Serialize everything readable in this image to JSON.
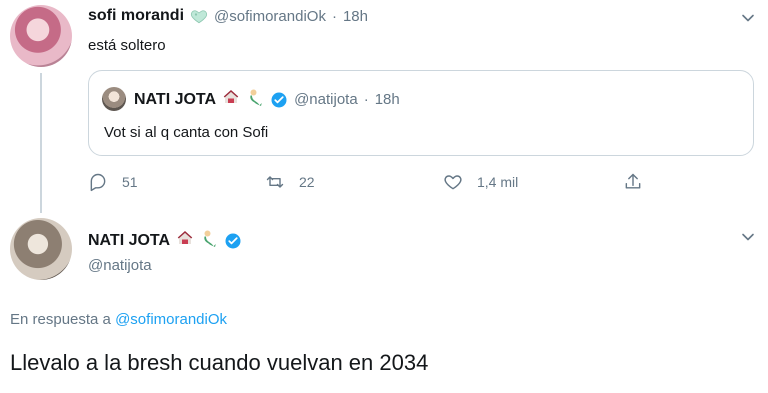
{
  "tweet1": {
    "name": "sofi morandi",
    "handle": "@sofimorandiOk",
    "separator": "·",
    "time": "18h",
    "text": "está soltero",
    "emoji_icon": "heart-emoji-icon"
  },
  "quoted": {
    "name": "NATI JOTA",
    "handle": "@natijota",
    "separator": "·",
    "time": "18h",
    "text": "Vot si al q canta con Sofi"
  },
  "actions": {
    "replies": "51",
    "retweets": "22",
    "likes": "1,4 mil"
  },
  "tweet2": {
    "name": "NATI JOTA",
    "handle": "@natijota",
    "reply_prefix": "En respuesta a",
    "reply_handle": "@sofimorandiOk",
    "text": "Llevalo a la bresh cuando vuelvan en 2034"
  },
  "colors": {
    "link": "#1da1f2",
    "muted": "#657786",
    "border": "#ccd6dd",
    "verified": "#1da1f2"
  }
}
